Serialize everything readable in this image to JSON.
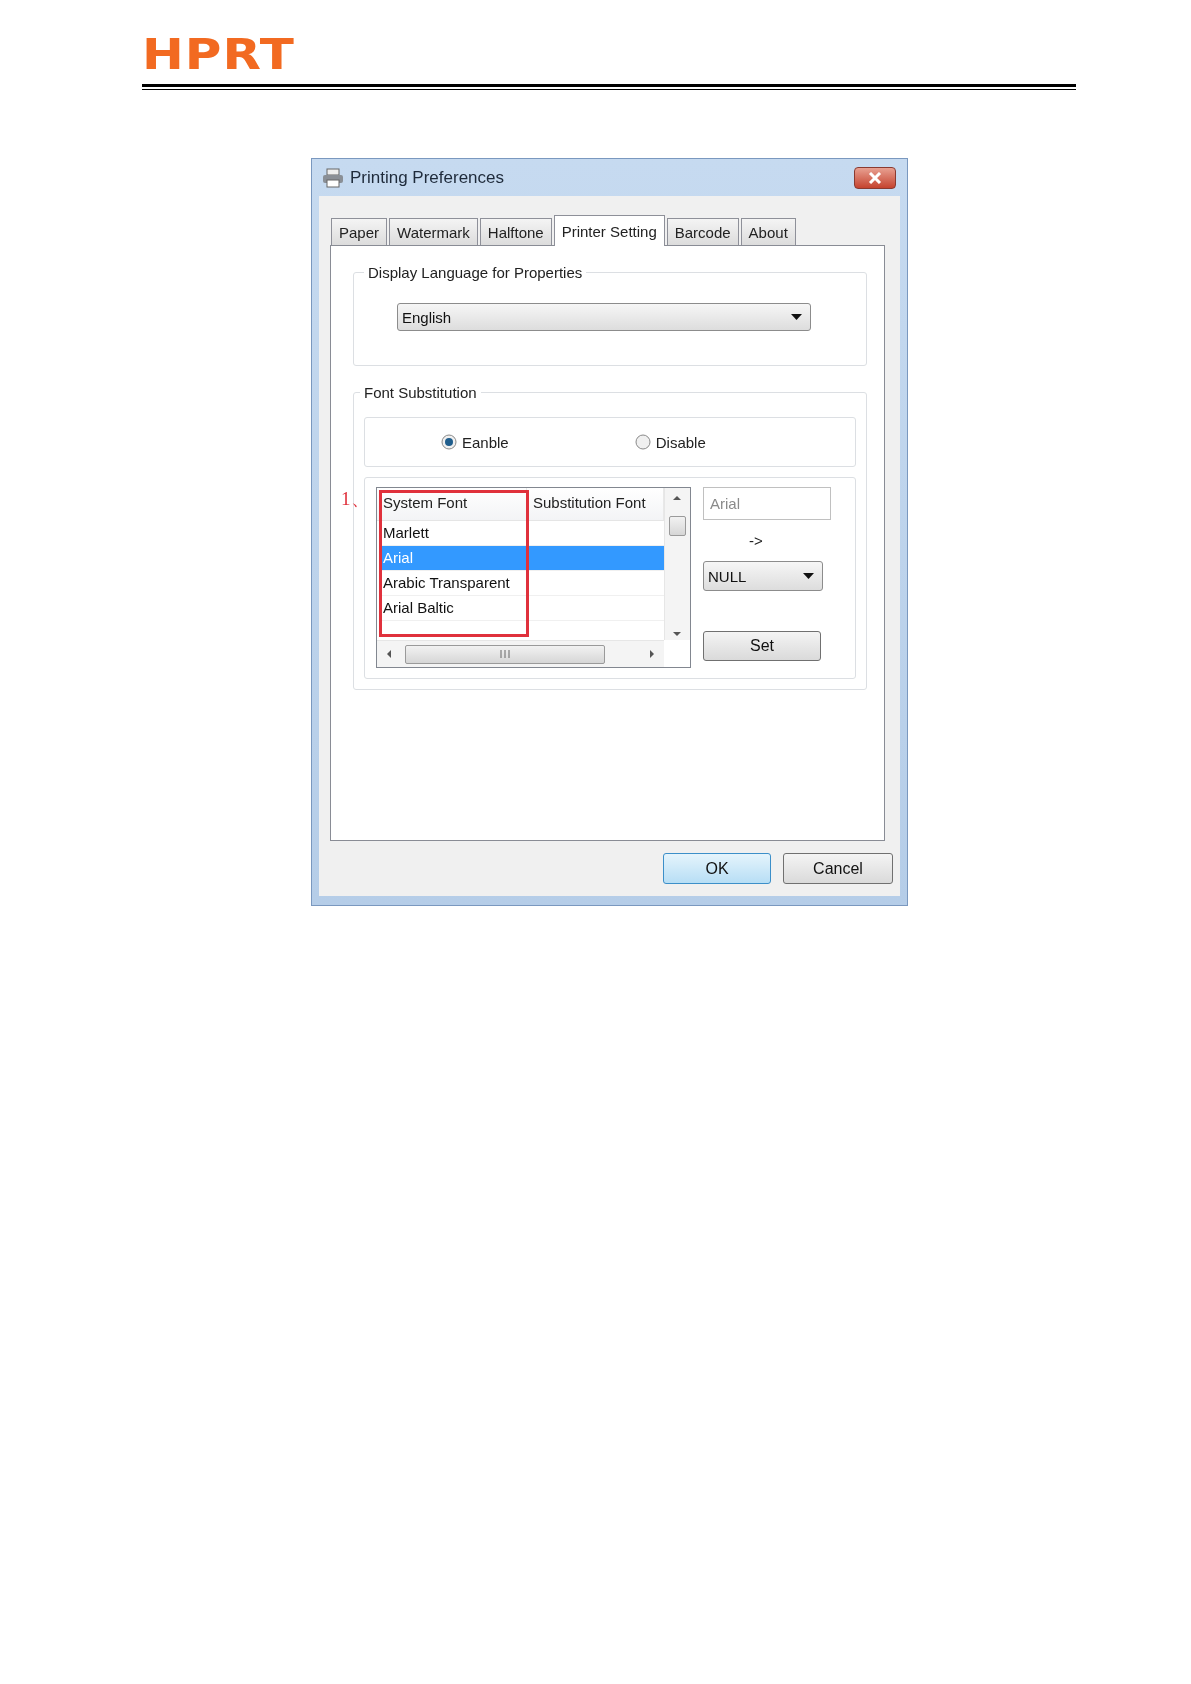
{
  "header": {
    "logo": "HPRT"
  },
  "window": {
    "title": "Printing Preferences"
  },
  "tabs": [
    {
      "label": "Paper",
      "selected": false
    },
    {
      "label": "Watermark",
      "selected": false
    },
    {
      "label": "Halftone",
      "selected": false
    },
    {
      "label": "Printer Setting",
      "selected": true
    },
    {
      "label": "Barcode",
      "selected": false
    },
    {
      "label": "About",
      "selected": false
    }
  ],
  "language_group": {
    "label": "Display Language for Properties",
    "value": "English"
  },
  "font_substitution": {
    "label": "Font Substitution",
    "options": [
      {
        "label": "Eanble",
        "selected": true
      },
      {
        "label": "Disable",
        "selected": false
      }
    ],
    "callout": "1、",
    "table": {
      "columns": [
        "System Font",
        "Substitution Font"
      ],
      "rows": [
        {
          "system_font": "Marlett",
          "selected": false
        },
        {
          "system_font": "Arial",
          "selected": true
        },
        {
          "system_font": "Arabic Transparent",
          "selected": false
        },
        {
          "system_font": "Arial Baltic",
          "selected": false
        }
      ]
    },
    "source_field": {
      "value": "Arial",
      "disabled": true
    },
    "arrow_label": "->",
    "target_dropdown": {
      "value": "NULL"
    },
    "set_button": "Set"
  },
  "buttons": [
    {
      "label": "OK",
      "default": true
    },
    {
      "label": "Cancel",
      "default": false
    }
  ]
}
